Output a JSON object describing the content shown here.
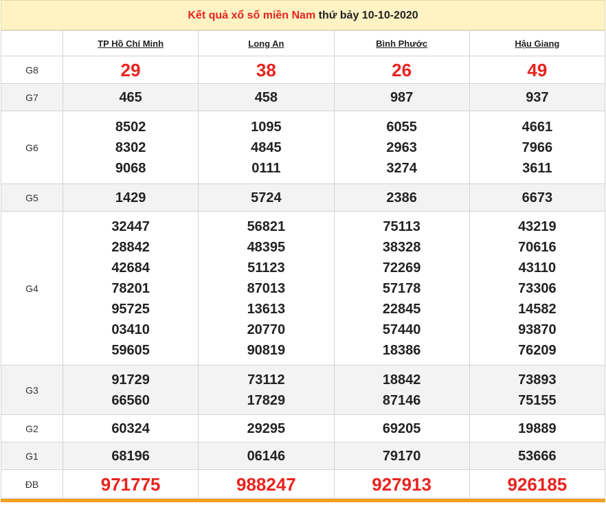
{
  "title": {
    "part1": "Kết quả xổ số miền Nam",
    "part2": "thứ bảy 10-10-2020"
  },
  "provinces": [
    "TP Hồ Chí Minh",
    "Long An",
    "Bình Phước",
    "Hậu Giang"
  ],
  "prizes": {
    "g8": {
      "label": "G8",
      "values": [
        [
          "29"
        ],
        [
          "38"
        ],
        [
          "26"
        ],
        [
          "49"
        ]
      ]
    },
    "g7": {
      "label": "G7",
      "values": [
        [
          "465"
        ],
        [
          "458"
        ],
        [
          "987"
        ],
        [
          "937"
        ]
      ]
    },
    "g6": {
      "label": "G6",
      "values": [
        [
          "8502",
          "8302",
          "9068"
        ],
        [
          "1095",
          "4845",
          "0111"
        ],
        [
          "6055",
          "2963",
          "3274"
        ],
        [
          "4661",
          "7966",
          "3611"
        ]
      ]
    },
    "g5": {
      "label": "G5",
      "values": [
        [
          "1429"
        ],
        [
          "5724"
        ],
        [
          "2386"
        ],
        [
          "6673"
        ]
      ]
    },
    "g4": {
      "label": "G4",
      "values": [
        [
          "32447",
          "28842",
          "42684",
          "78201",
          "95725",
          "03410",
          "59605"
        ],
        [
          "56821",
          "48395",
          "51123",
          "87013",
          "13613",
          "20770",
          "90819"
        ],
        [
          "75113",
          "38328",
          "72269",
          "57178",
          "22845",
          "57440",
          "18386"
        ],
        [
          "43219",
          "70616",
          "43110",
          "73306",
          "14582",
          "93870",
          "76209"
        ]
      ]
    },
    "g3": {
      "label": "G3",
      "values": [
        [
          "91729",
          "66560"
        ],
        [
          "73112",
          "17829"
        ],
        [
          "18842",
          "87146"
        ],
        [
          "73893",
          "75155"
        ]
      ]
    },
    "g2": {
      "label": "G2",
      "values": [
        [
          "60324"
        ],
        [
          "29295"
        ],
        [
          "69205"
        ],
        [
          "19889"
        ]
      ]
    },
    "g1": {
      "label": "G1",
      "values": [
        [
          "68196"
        ],
        [
          "06146"
        ],
        [
          "79170"
        ],
        [
          "53666"
        ]
      ]
    },
    "db": {
      "label": "ĐB",
      "values": [
        [
          "971775"
        ],
        [
          "988247"
        ],
        [
          "927913"
        ],
        [
          "926185"
        ]
      ]
    }
  },
  "colors": {
    "accent_red": "#e8231f",
    "title_bg": "#fff3c4",
    "bottom_bar": "#f0a020"
  }
}
